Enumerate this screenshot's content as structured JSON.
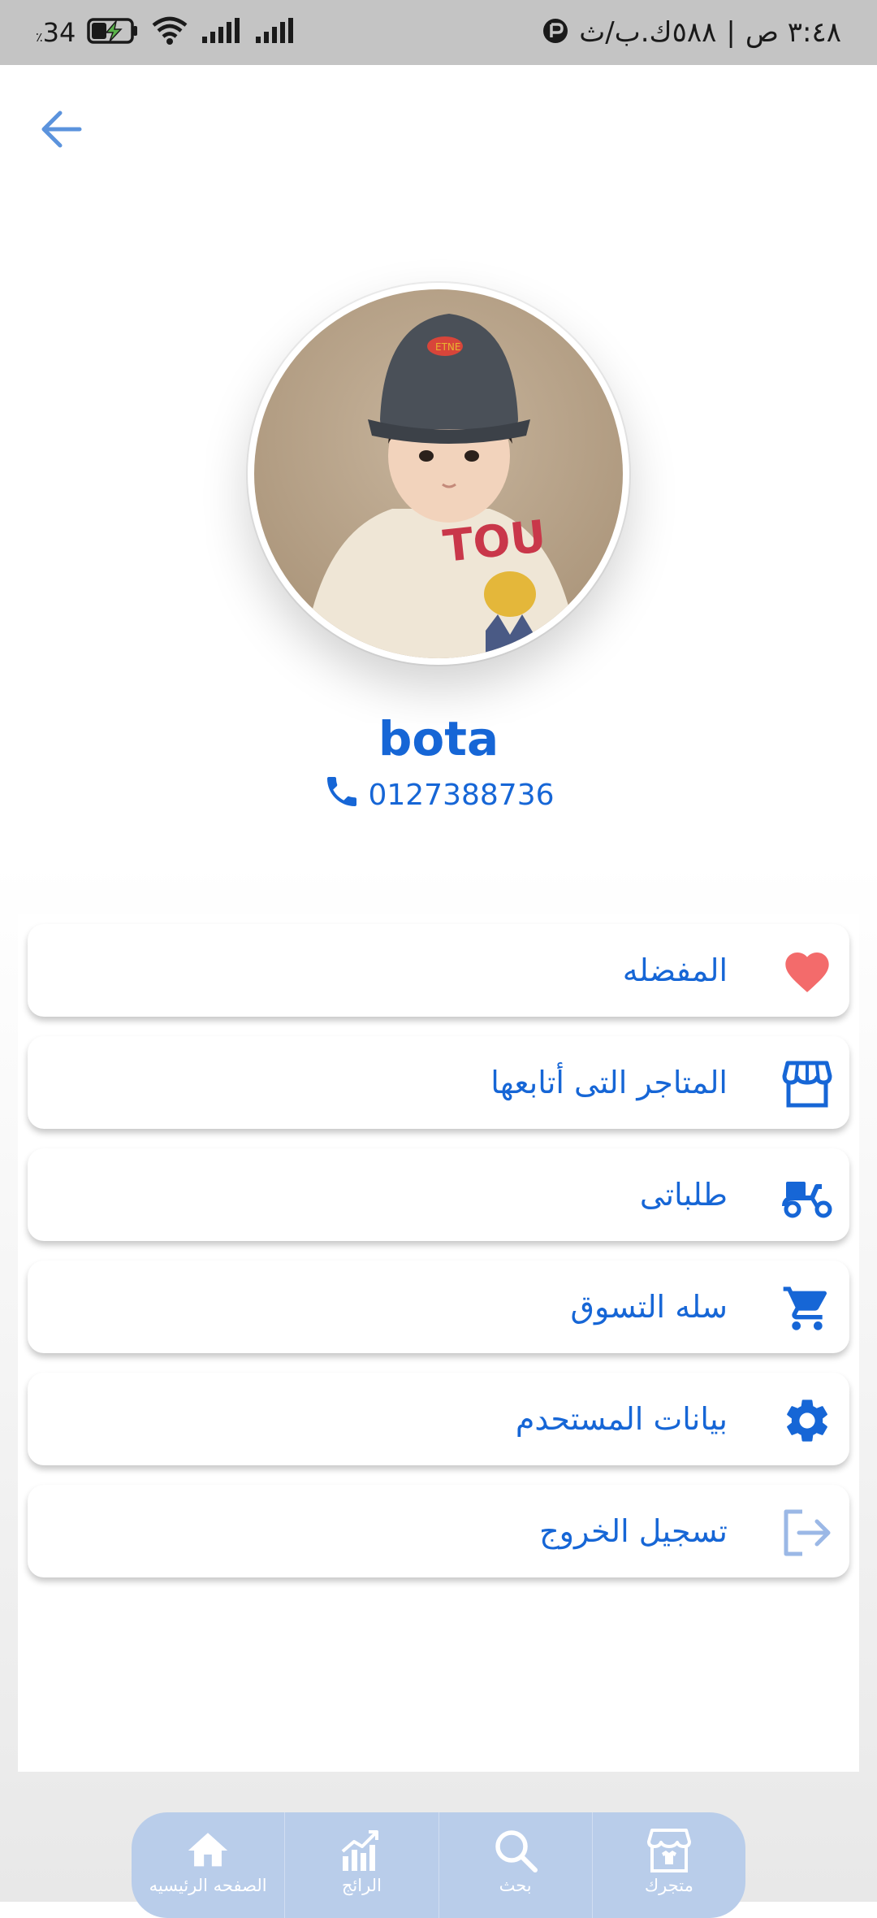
{
  "status_bar": {
    "battery_text": "34",
    "battery_suffix": "٪",
    "time": "٣:٤٨ ص",
    "separator": "|",
    "speed": "٥٨٨ك.ب/ث"
  },
  "profile": {
    "name": "bota",
    "phone": "0127388736"
  },
  "menu": [
    {
      "label": "المفضله",
      "icon": "heart-icon",
      "color": "#f36b6b"
    },
    {
      "label": "المتاجر التى أتابعها",
      "icon": "store-icon",
      "color": "#1666d6"
    },
    {
      "label": "طلباتى",
      "icon": "delivery-scooter-icon",
      "color": "#1666d6"
    },
    {
      "label": "سله التسوق",
      "icon": "cart-icon",
      "color": "#1666d6"
    },
    {
      "label": "بيانات المستحدم",
      "icon": "gear-icon",
      "color": "#1666d6"
    },
    {
      "label": "تسجيل الخروج",
      "icon": "logout-icon",
      "color": "#9bb8e6"
    }
  ],
  "bottom_nav": [
    {
      "label": "الصفحه الرئيسيه",
      "icon": "home-icon"
    },
    {
      "label": "الرائج",
      "icon": "trending-chart-icon"
    },
    {
      "label": "بحث",
      "icon": "search-icon"
    },
    {
      "label": "متجرك",
      "icon": "shop-icon"
    }
  ],
  "colors": {
    "accent": "#1666d6",
    "nav_bg": "#b9cdea",
    "status_bar_bg": "#c4c4c4"
  }
}
